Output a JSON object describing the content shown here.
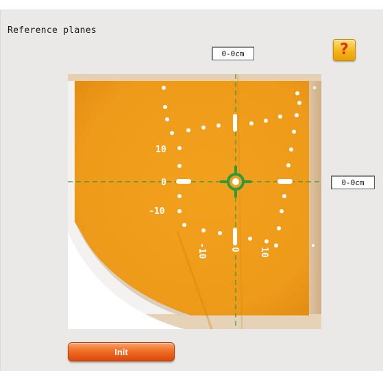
{
  "panel": {
    "title": "Reference planes"
  },
  "help": {
    "label": "?"
  },
  "readouts": {
    "top": "0-0cm",
    "right": "0-0cm"
  },
  "scale": {
    "left_labels": [
      "10",
      "0",
      "-10"
    ],
    "bottom_labels": [
      "-10",
      "0",
      "10"
    ]
  },
  "init": {
    "label": "Init"
  },
  "colors": {
    "background": "#eae9e7",
    "film": "#f0a020",
    "crosshair": "#2e9a3c",
    "button": "#f06a20"
  }
}
